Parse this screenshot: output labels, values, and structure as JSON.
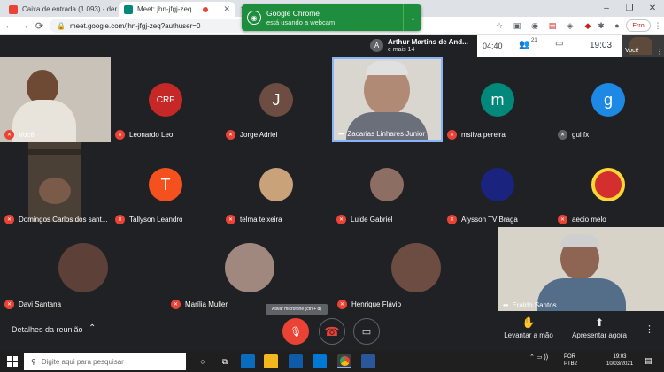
{
  "browser": {
    "tabs": [
      {
        "title": "Caixa de entrada (1.093) - dens.c",
        "color": "#ea4335"
      },
      {
        "title": "Meet: jhn-jfgj-zeq",
        "color": "#00897b"
      }
    ],
    "new_tab": "+",
    "url": "meet.google.com/jhn-jfgj-zeq?authuser=0",
    "error_badge": "Erro",
    "window_controls": [
      "–",
      "❐",
      "✕"
    ]
  },
  "notification": {
    "line1": "Google Chrome",
    "line2": "está usando a webcam"
  },
  "meeting": {
    "presenter_name": "Arthur Martins de And...",
    "presenter_extra": "e mais 14",
    "presenter_initial": "A",
    "clock": "04:40",
    "participant_count": "21",
    "time": "19:03",
    "self_label": "Você"
  },
  "participants": [
    {
      "name": "Você",
      "type": "video"
    },
    {
      "name": "Leonardo Leo",
      "type": "logo"
    },
    {
      "name": "Jorge Adriel",
      "initial": "J",
      "color": "#6d4c41"
    },
    {
      "name": "Zacarias Linhares Junior",
      "type": "video",
      "speaking": true
    },
    {
      "name": "msilva pereira",
      "initial": "m",
      "color": "#00897b"
    },
    {
      "name": "gui fx",
      "initial": "g",
      "color": "#1e88e5"
    },
    {
      "name": "Domingos Carlos dos sant...",
      "type": "video"
    },
    {
      "name": "Tallyson Leandro",
      "initial": "T",
      "color": "#f4511e"
    },
    {
      "name": "telma teixeira",
      "type": "photo"
    },
    {
      "name": "Luide Gabriel",
      "type": "photo"
    },
    {
      "name": "Alysson TV Braga",
      "type": "photo"
    },
    {
      "name": "aecio melo",
      "type": "photo"
    },
    {
      "name": "Davi Santana",
      "type": "photo"
    },
    {
      "name": "Marília Muller",
      "type": "photo"
    },
    {
      "name": "Henrique Flávio",
      "type": "photo"
    },
    {
      "name": "Eraldo Santos",
      "type": "video"
    }
  ],
  "controls": {
    "details": "Detalhes da reunião",
    "tooltip": "Ativar microfone (ctrl + d)",
    "raise_hand": "Levantar a mão",
    "present": "Apresentar agora"
  },
  "taskbar": {
    "search_placeholder": "Digite aqui para pesquisar",
    "lang1": "POR",
    "lang2": "PTB2",
    "time": "19:03",
    "date": "10/03/2021"
  }
}
